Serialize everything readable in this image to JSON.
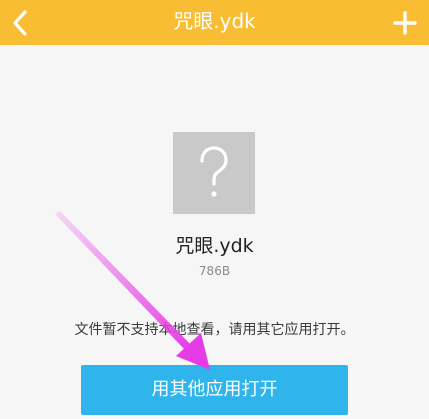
{
  "header": {
    "title": "咒眼.ydk",
    "back_icon": "chevron-left-icon",
    "add_icon": "plus-icon",
    "background_color": "#f9bd34"
  },
  "file": {
    "icon": "question-mark-icon",
    "name": "咒眼.ydk",
    "size": "786B"
  },
  "notice": "文件暂不支持本地查看，请用其它应用打开。",
  "actions": {
    "open_with_other_app_label": "用其他应用打开",
    "button_color": "#2fb4ec"
  },
  "annotation": {
    "arrow_color": "#e63ce6"
  }
}
